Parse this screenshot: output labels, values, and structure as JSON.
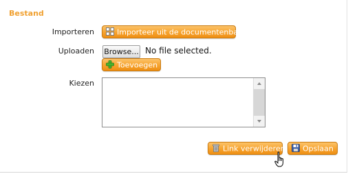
{
  "section": {
    "title": "Bestand"
  },
  "import": {
    "label": "Importeren",
    "button_label": "Importeer uit de documentenbank..."
  },
  "upload": {
    "label": "Uploaden",
    "browse_label": "Browse...",
    "file_status": "No file selected.",
    "add_button_label": "Toevoegen"
  },
  "choose": {
    "label": "Kiezen",
    "items": []
  },
  "actions": {
    "delete_link_label": "Link verwijderen",
    "save_label": "Opslaan"
  },
  "colors": {
    "accent": "#f0a030",
    "button_gradient_top": "#fcc36a",
    "button_gradient_bottom": "#ee8e12",
    "button_border": "#c97a10"
  },
  "icons": {
    "import": "grid-icon",
    "add": "plus-icon",
    "delete": "trash-icon",
    "save": "floppy-disk-icon",
    "scroll_up": "arrow-up-icon",
    "scroll_down": "arrow-down-icon",
    "cursor": "hand-pointer-cursor"
  }
}
